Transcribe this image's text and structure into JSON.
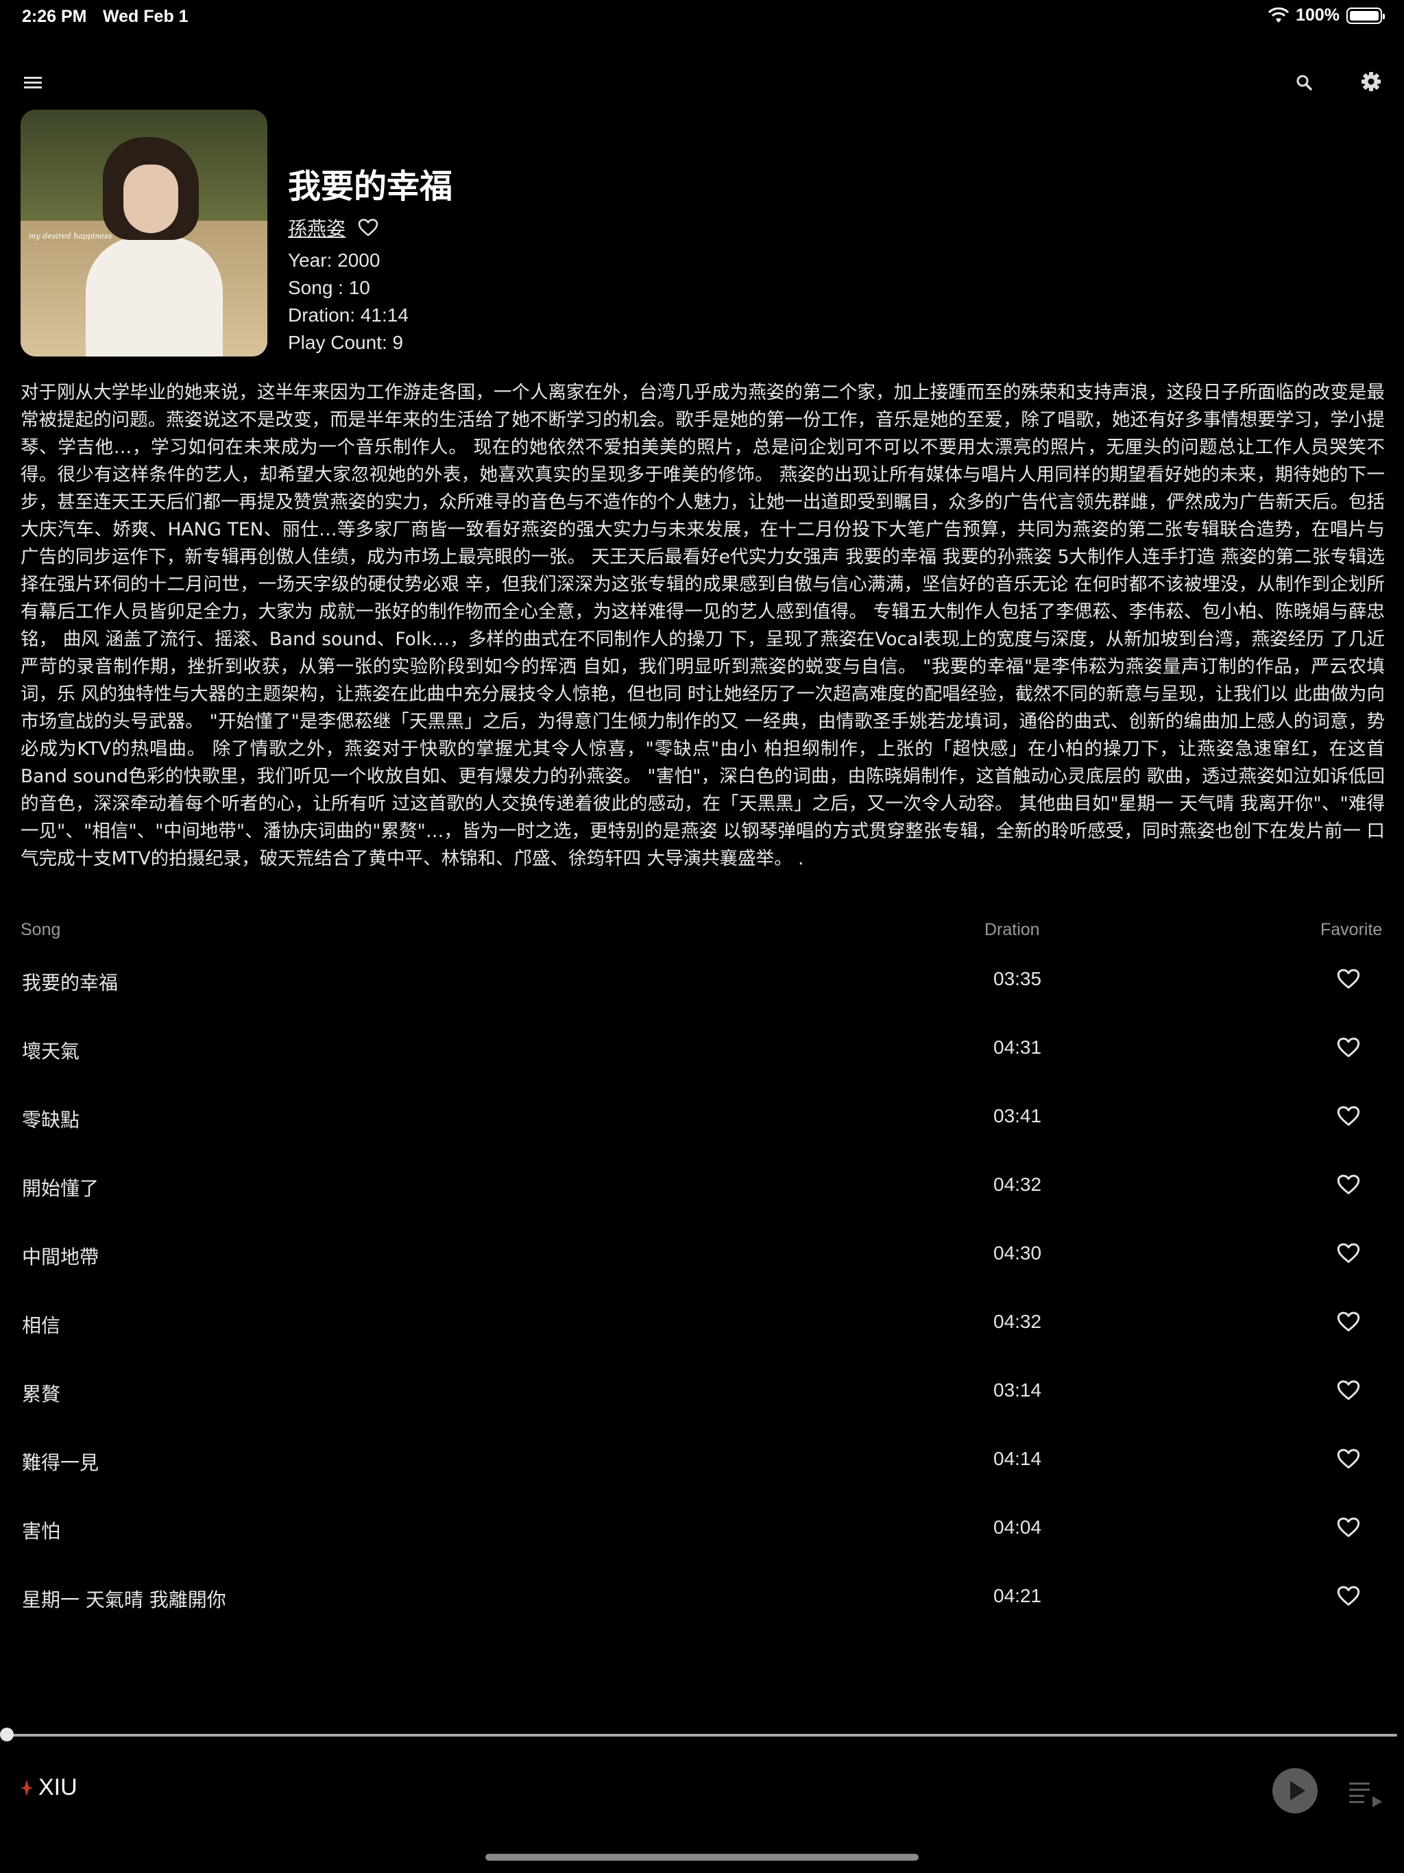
{
  "status_bar": {
    "time": "2:26 PM",
    "date": "Wed Feb 1",
    "battery": "100%"
  },
  "toolbar": {
    "menu_icon": "hamburger-menu-icon",
    "search_icon": "search-icon",
    "settings_icon": "gear-icon"
  },
  "album": {
    "title": "我要的幸福",
    "artist": "孫燕姿",
    "year": "Year: 2000",
    "song_count": "Song : 10",
    "duration": "Dration: 41:14",
    "play_count": "Play Count: 9",
    "cover_caption": "my desired happiness",
    "description": "对于刚从大学毕业的她来说，这半年来因为工作游走各国，一个人离家在外，台湾几乎成为燕姿的第二个家，加上接踵而至的殊荣和支持声浪，这段日子所面临的改变是最常被提起的问题。燕姿说这不是改变，而是半年来的生活给了她不断学习的机会。歌手是她的第一份工作，音乐是她的至爱，除了唱歌，她还有好多事情想要学习，学小提琴、学吉他…，学习如何在未来成为一个音乐制作人。 现在的她依然不爱拍美美的照片，总是问企划可不可以不要用太漂亮的照片，无厘头的问题总让工作人员哭笑不得。很少有这样条件的艺人，却希望大家忽视她的外表，她喜欢真实的呈现多于唯美的修饰。 燕姿的出现让所有媒体与唱片人用同样的期望看好她的未来，期待她的下一步，甚至连天王天后们都一再提及赞赏燕姿的实力，众所难寻的音色与不造作的个人魅力，让她一出道即受到瞩目，众多的广告代言领先群雌，俨然成为广告新天后。包括大庆汽车、娇爽、HANG TEN、丽仕…等多家厂商皆一致看好燕姿的强大实力与未来发展，在十二月份投下大笔广告预算，共同为燕姿的第二张专辑联合造势，在唱片与广告的同步运作下，新专辑再创傲人佳绩，成为市场上最亮眼的一张。 天王天后最看好e代实力女强声 我要的幸福 我要的孙燕姿 5大制作人连手打造 燕姿的第二张专辑选择在强片环伺的十二月问世，一场天字级的硬仗势必艰 辛，但我们深深为这张专辑的成果感到自傲与信心满满，坚信好的音乐无论 在何时都不该被埋没，从制作到企划所有幕后工作人员皆卯足全力，大家为 成就一张好的制作物而全心全意，为这样难得一见的艺人感到值得。 专辑五大制作人包括了李偲菘、李伟菘、包小柏、陈晓娟与薛忠铭， 曲风 涵盖了流行、摇滚、Band sound、Folk…，多样的曲式在不同制作人的操刀 下，呈现了燕姿在Vocal表现上的宽度与深度，从新加坡到台湾，燕姿经历 了几近严苛的录音制作期，挫折到收获，从第一张的实验阶段到如今的挥洒 自如，我们明显听到燕姿的蜕变与自信。 \"我要的幸福\"是李伟菘为燕姿量声订制的作品，严云农填词，乐 风的独特性与大器的主题架构，让燕姿在此曲中充分展技令人惊艳，但也同 时让她经历了一次超高难度的配唱经验，截然不同的新意与呈现，让我们以 此曲做为向市场宣战的头号武器。 \"开始懂了\"是李偲菘继「天黑黑」之后，为得意门生倾力制作的又 一经典，由情歌圣手姚若龙填词，通俗的曲式、创新的编曲加上感人的词意，势必成为KTV的热唱曲。 除了情歌之外，燕姿对于快歌的掌握尤其令人惊喜，\"零缺点\"由小 柏担纲制作，上张的「超快感」在小柏的操刀下，让燕姿急速窜红，在这首 Band sound色彩的快歌里，我们听见一个收放自如、更有爆发力的孙燕姿。 \"害怕\"，深白色的词曲，由陈晓娟制作，这首触动心灵底层的 歌曲，透过燕姿如泣如诉低回的音色，深深牵动着每个听者的心，让所有听 过这首歌的人交换传递着彼此的感动，在「天黑黑」之后，又一次令人动容。 其他曲目如\"星期一 天气晴 我离开你\"、\"难得一见\"、\"相信\"、\"中间地带\"、潘协庆词曲的\"累赘\"…，皆为一时之选，更特别的是燕姿 以钢琴弹唱的方式贯穿整张专辑，全新的聆听感受，同时燕姿也创下在发片前一 口气完成十支MTV的拍摄纪录，破天荒结合了黄中平、林锦和、邝盛、徐筠轩四 大导演共襄盛举。 ."
  },
  "table": {
    "headers": {
      "song": "Song",
      "duration": "Dration",
      "favorite": "Favorite"
    },
    "rows": [
      {
        "title": "我要的幸福",
        "duration": "03:35"
      },
      {
        "title": "壞天氣",
        "duration": "04:31"
      },
      {
        "title": "零缺點",
        "duration": "03:41"
      },
      {
        "title": "開始懂了",
        "duration": "04:32"
      },
      {
        "title": "中間地帶",
        "duration": "04:30"
      },
      {
        "title": "相信",
        "duration": "04:32"
      },
      {
        "title": "累贅",
        "duration": "03:14"
      },
      {
        "title": "難得一見",
        "duration": "04:14"
      },
      {
        "title": "害怕",
        "duration": "04:04"
      },
      {
        "title": "星期一 天氣晴 我離開你",
        "duration": "04:21"
      }
    ]
  },
  "player": {
    "progress": 0,
    "brand": "XIU",
    "play_icon": "play-icon",
    "queue_icon": "queue-icon"
  }
}
